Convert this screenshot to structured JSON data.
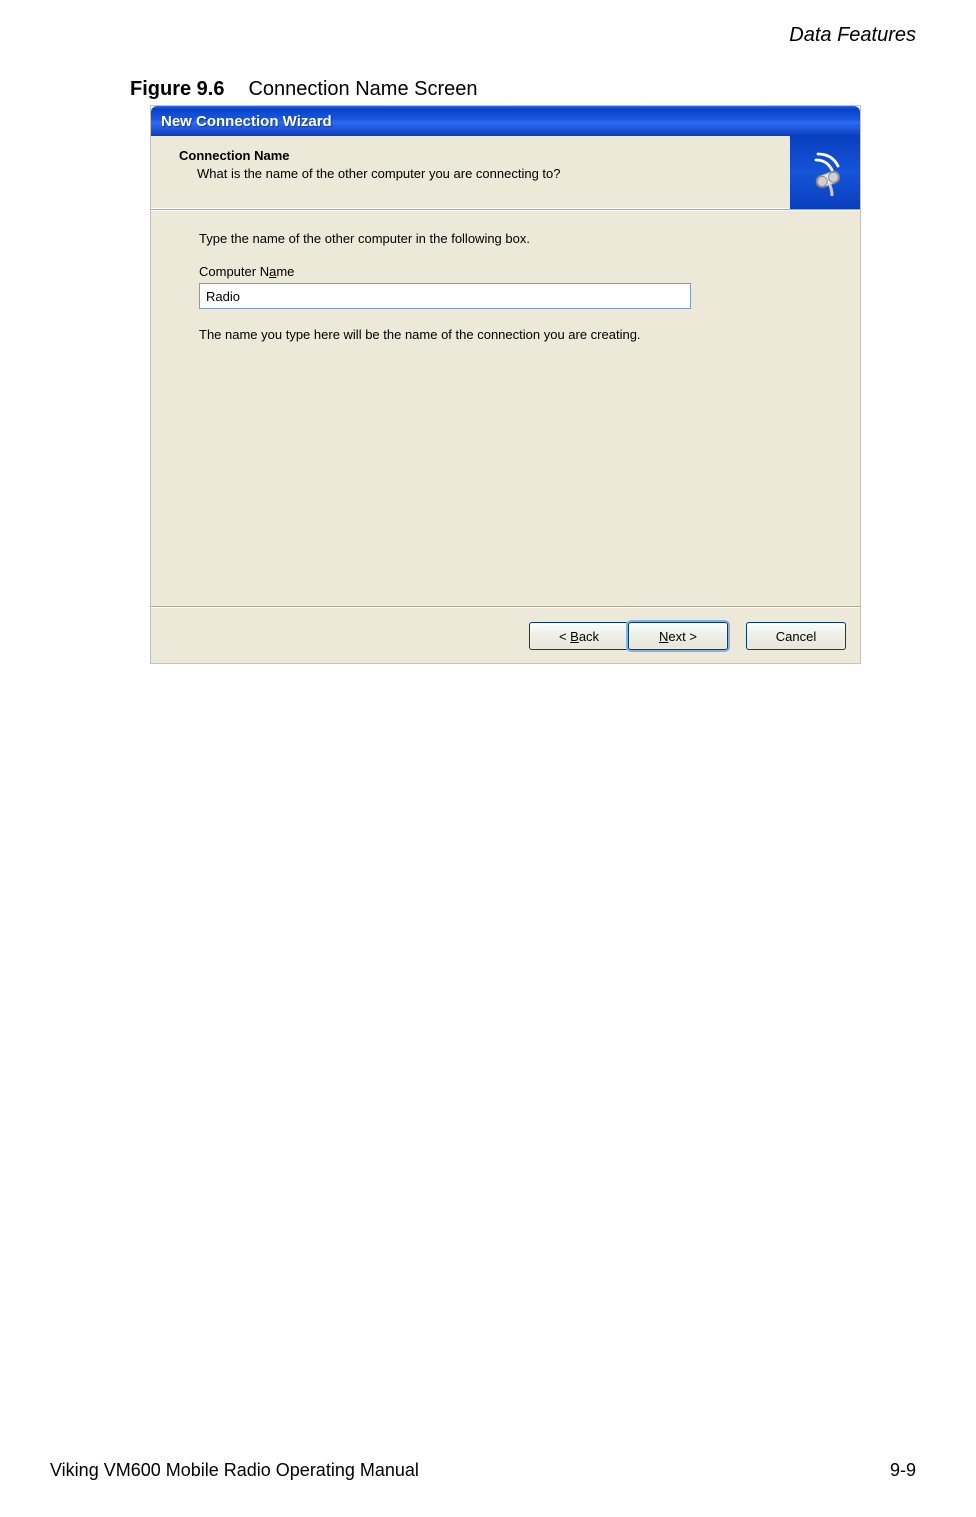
{
  "page": {
    "header": "Data Features",
    "footer_left": "Viking VM600 Mobile Radio Operating Manual",
    "footer_right": "9-9"
  },
  "figure": {
    "number": "Figure 9.6",
    "title": "Connection Name Screen"
  },
  "wizard": {
    "titlebar": "New Connection Wizard",
    "header_title": "Connection Name",
    "header_subtitle": "What is the name of the other computer you are connecting to?",
    "body": {
      "instruction": "Type the name of the other computer in the following box.",
      "label_prefix": "Computer N",
      "label_underline": "a",
      "label_suffix": "me",
      "input_value": "Radio",
      "note": "The name you type here will be the name of the connection you are creating."
    },
    "buttons": {
      "back_prefix": "< ",
      "back_underline": "B",
      "back_suffix": "ack",
      "next_underline": "N",
      "next_suffix": "ext >",
      "cancel": "Cancel"
    }
  }
}
